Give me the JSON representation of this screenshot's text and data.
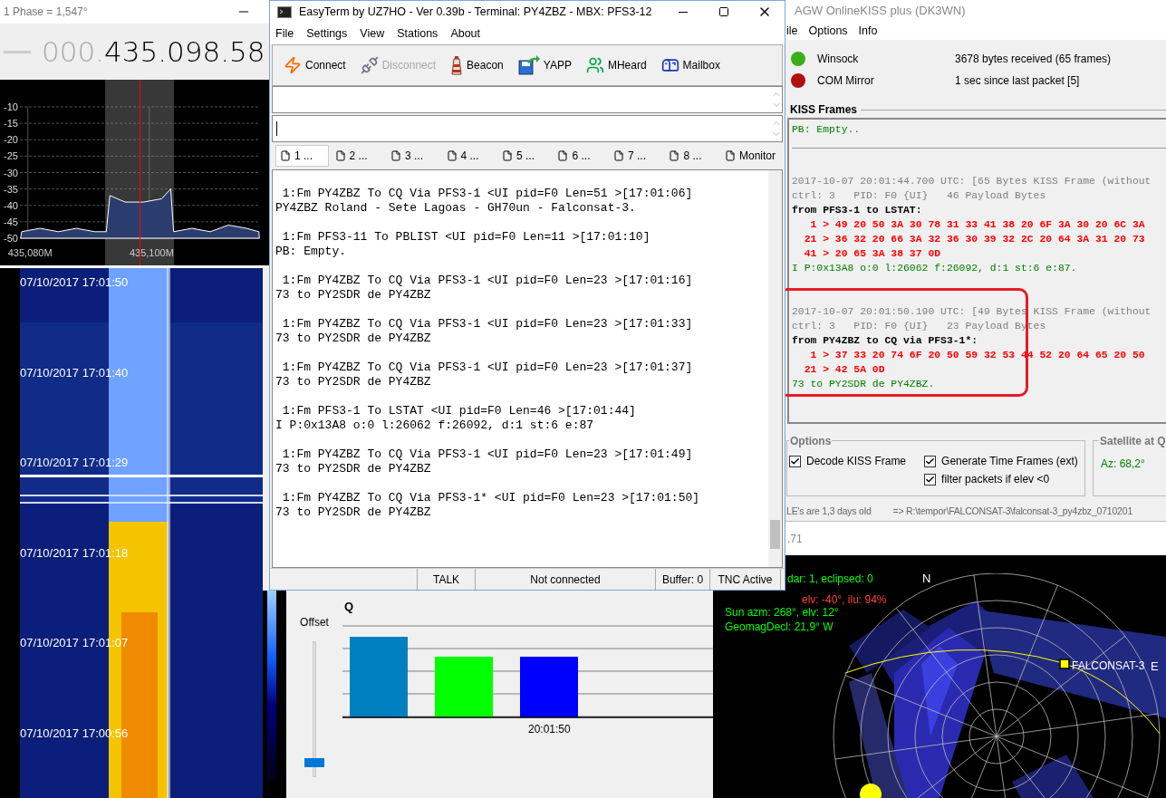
{
  "sdr_window": {
    "title": "1 Phase = 1,547°",
    "frequency_prefix": "000.",
    "frequency": "435.098.58",
    "spectrum": {
      "chart_data": {
        "type": "area",
        "grid": true,
        "x": [
          435078.8,
          435079,
          435082,
          435085,
          435088,
          435091,
          435092.9,
          435093.5,
          435096,
          435099,
          435102,
          435103.5,
          435104,
          435107,
          435110,
          435113,
          435116,
          435118,
          435118.1
        ],
        "series": [
          {
            "color": "#ffffff",
            "values": [
              -50,
              -48,
              -47,
              -48,
              -47,
              -48,
              -48,
              -37,
              -39,
              -39,
              -38,
              -35,
              -48,
              -47,
              -48,
              -46,
              -47,
              -48,
              -50
            ]
          }
        ],
        "xlim": [
          435078.7,
          435118.2
        ],
        "ylim": [
          -50,
          -10
        ],
        "xticks": [
          {
            "value": 435080,
            "label": "435,080M"
          },
          {
            "value": 435100,
            "label": "435,100M"
          }
        ],
        "yticks": [
          -10,
          -15,
          -20,
          -25,
          -30,
          -35,
          -40,
          -45,
          -50
        ]
      }
    },
    "waterfall_times": [
      "07/10/2017 17:01:50",
      "07/10/2017 17:01:40",
      "07/10/2017 17:01:29",
      "07/10/2017 17:01:18",
      "07/10/2017 17:01:07",
      "07/10/2017 17:00:56"
    ]
  },
  "easyterm": {
    "title": "EasyTerm by UZ7HO - Ver 0.39b - Terminal: PY4ZBZ - MBX: PFS3-12",
    "menu": [
      "File",
      "Settings",
      "View",
      "Stations",
      "About"
    ],
    "toolbar": [
      {
        "label": "Connect",
        "disabled": false
      },
      {
        "label": "Disconnect",
        "disabled": true
      },
      {
        "label": "Beacon",
        "disabled": false
      },
      {
        "label": "YAPP",
        "disabled": false
      },
      {
        "label": "MHeard",
        "disabled": false
      },
      {
        "label": "Mailbox",
        "disabled": false
      }
    ],
    "tabs": [
      {
        "label": "1 ...",
        "selected": true
      },
      {
        "label": "2 ...",
        "selected": false
      },
      {
        "label": "3 ...",
        "selected": false
      },
      {
        "label": "4 ...",
        "selected": false
      },
      {
        "label": "5 ...",
        "selected": false
      },
      {
        "label": "6 ...",
        "selected": false
      },
      {
        "label": "7 ...",
        "selected": false
      },
      {
        "label": "8 ...",
        "selected": false
      },
      {
        "label": "Monitor",
        "selected": false
      }
    ],
    "terminal": [
      {
        "header": " 1:Fm PY4ZBZ To CQ Via PFS3-1 <UI pid=F0 Len=51 >[17:01:06]",
        "body": "PY4ZBZ Roland - Sete Lagoas - GH70un - Falconsat-3."
      },
      {
        "header": " 1:Fm PFS3-11 To PBLIST <UI pid=F0 Len=11 >[17:01:10]",
        "body": "PB: Empty."
      },
      {
        "header": " 1:Fm PY4ZBZ To CQ Via PFS3-1 <UI pid=F0 Len=23 >[17:01:16]",
        "body": "73 to PY2SDR de PY4ZBZ"
      },
      {
        "header": " 1:Fm PY4ZBZ To CQ Via PFS3-1 <UI pid=F0 Len=23 >[17:01:33]",
        "body": "73 to PY2SDR de PY4ZBZ"
      },
      {
        "header": " 1:Fm PY4ZBZ To CQ Via PFS3-1 <UI pid=F0 Len=23 >[17:01:37]",
        "body": "73 to PY2SDR de PY4ZBZ"
      },
      {
        "header": " 1:Fm PFS3-1 To LSTAT <UI pid=F0 Len=46 >[17:01:44]",
        "body": "I P:0x13A8 o:0 l:26062 f:26092, d:1 st:6 e:87"
      },
      {
        "header": " 1:Fm PY4ZBZ To CQ Via PFS3-1 <UI pid=F0 Len=23 >[17:01:49]",
        "body": "73 to PY2SDR de PY4ZBZ"
      },
      {
        "header": " 1:Fm PY4ZBZ To CQ Via PFS3-1* <UI pid=F0 Len=23 >[17:01:50]",
        "body": "73 to PY2SDR de PY4ZBZ"
      }
    ],
    "status_bar": [
      "TALK",
      "Not connected",
      "Buffer: 0",
      "TNC Active"
    ]
  },
  "agw": {
    "title": "AGW OnlineKISS plus (DK3WN)",
    "menu": [
      "ile",
      "Options",
      "Info"
    ],
    "status": [
      {
        "label": "Winsock",
        "on": true,
        "info": "3678 bytes received (65 frames)"
      },
      {
        "label": "COM Mirror",
        "on": false,
        "info": "1 sec since last packet [5]"
      }
    ],
    "kiss_title": "KISS Frames",
    "frames": [
      {
        "highlighted": false,
        "divided": true,
        "lines": [
          {
            "kind": "decoded",
            "text": "PB: Empty.."
          }
        ]
      },
      {
        "highlighted": false,
        "divided": false,
        "lines": [
          {
            "kind": "header",
            "text": "2017-10-07 20:01:44.700 UTC: [65 Bytes KISS Frame (without"
          },
          {
            "kind": "header",
            "text": "ctrl: 3   PID: F0 {UI}   46 Payload Bytes"
          },
          {
            "kind": "address",
            "text": "from PFS3-1 to LSTAT:"
          },
          {
            "kind": "hex",
            "text": "   1 > 49 20 50 3A 30 78 31 33 41 38 20 6F 3A 30 20 6C 3A"
          },
          {
            "kind": "hex",
            "text": "  21 > 36 32 20 66 3A 32 36 30 39 32 2C 20 64 3A 31 20 73"
          },
          {
            "kind": "hex",
            "text": "  41 > 20 65 3A 38 37 0D"
          },
          {
            "kind": "decoded",
            "text": "I P:0x13A8 o:0 l:26062 f:26092, d:1 st:6 e:87."
          }
        ]
      },
      {
        "highlighted": true,
        "divided": false,
        "lines": [
          {
            "kind": "header",
            "text": "2017-10-07 20:01:50.190 UTC: [49 Bytes KISS Frame (without"
          },
          {
            "kind": "header",
            "text": "ctrl: 3   PID: F0 {UI}   23 Payload Bytes"
          },
          {
            "kind": "address",
            "text": "from PY4ZBZ to CQ via PFS3-1*:"
          },
          {
            "kind": "hex",
            "text": "   1 > 37 33 20 74 6F 20 50 59 32 53 44 52 20 64 65 20 50"
          },
          {
            "kind": "hex",
            "text": "  21 > 42 5A 0D"
          },
          {
            "kind": "decoded",
            "text": "73 to PY2SDR de PY4ZBZ."
          }
        ]
      }
    ],
    "options": {
      "title": "Options",
      "checkboxes": [
        {
          "label": "Decode KISS Frame",
          "checked": true
        },
        {
          "label": "Generate Time Frames (ext)",
          "checked": true
        },
        {
          "label": "filter packets if elev <0",
          "checked": true
        }
      ]
    },
    "satellite": {
      "title": "Satellite at Q",
      "azimuth": "Az: 68,2°"
    },
    "status_line": [
      "LE's are 1,3 days old",
      "=> R:\\tempor\\FALCONSAT-3\\falconsat-3_py4zbz_0710201"
    ],
    "footer": ".71"
  },
  "chart_window": {
    "title": "Q",
    "offset_label": "Offset",
    "offset_slider": {
      "level": 0.07
    },
    "time_label": "20:01:50",
    "bars": [
      {
        "color": "#0080c0"
      },
      {
        "color": "#00ff00"
      },
      {
        "color": "#0000ff"
      }
    ]
  },
  "polar_window": {
    "lines": [
      {
        "text": "dar: 1, eclipsed: 0",
        "color": "#00ff00"
      },
      {
        "text": "elv: -40°, ilu: 94%",
        "color": "#ff4040"
      },
      {
        "text": "Sun azm: 268°, elv: 12°",
        "color": "#00ff00"
      },
      {
        "text": "GeomagDecl: 21,9° W",
        "color": "#00ff00"
      }
    ],
    "north": "N",
    "east": "E",
    "satellite": "FALCONSAT-3"
  }
}
